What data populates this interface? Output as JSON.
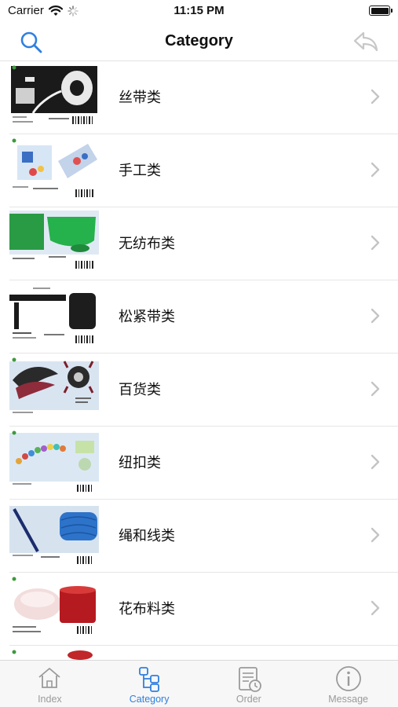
{
  "status_bar": {
    "carrier": "Carrier",
    "time": "11:15 PM"
  },
  "nav": {
    "title": "Category",
    "search_icon": "search-icon",
    "back_icon": "reply-icon"
  },
  "categories": [
    {
      "label": "丝带类",
      "icon": "ribbon-product-thumbnail"
    },
    {
      "label": "手工类",
      "icon": "craft-product-thumbnail"
    },
    {
      "label": "无纺布类",
      "icon": "nonwoven-product-thumbnail"
    },
    {
      "label": "松紧带类",
      "icon": "elastic-product-thumbnail"
    },
    {
      "label": "百货类",
      "icon": "feather-product-thumbnail"
    },
    {
      "label": "纽扣类",
      "icon": "button-product-thumbnail"
    },
    {
      "label": "绳和线类",
      "icon": "cord-product-thumbnail"
    },
    {
      "label": "花布料类",
      "icon": "fabric-product-thumbnail"
    }
  ],
  "tabs": [
    {
      "label": "Index",
      "icon": "house-icon",
      "active": false
    },
    {
      "label": "Category",
      "icon": "category-tree-icon",
      "active": true
    },
    {
      "label": "Order",
      "icon": "order-list-icon",
      "active": false
    },
    {
      "label": "Message",
      "icon": "info-icon",
      "active": false
    }
  ],
  "colors": {
    "accent": "#2f7fe0",
    "inactive": "#9a9a9a",
    "chevron": "#c4c4c4"
  }
}
